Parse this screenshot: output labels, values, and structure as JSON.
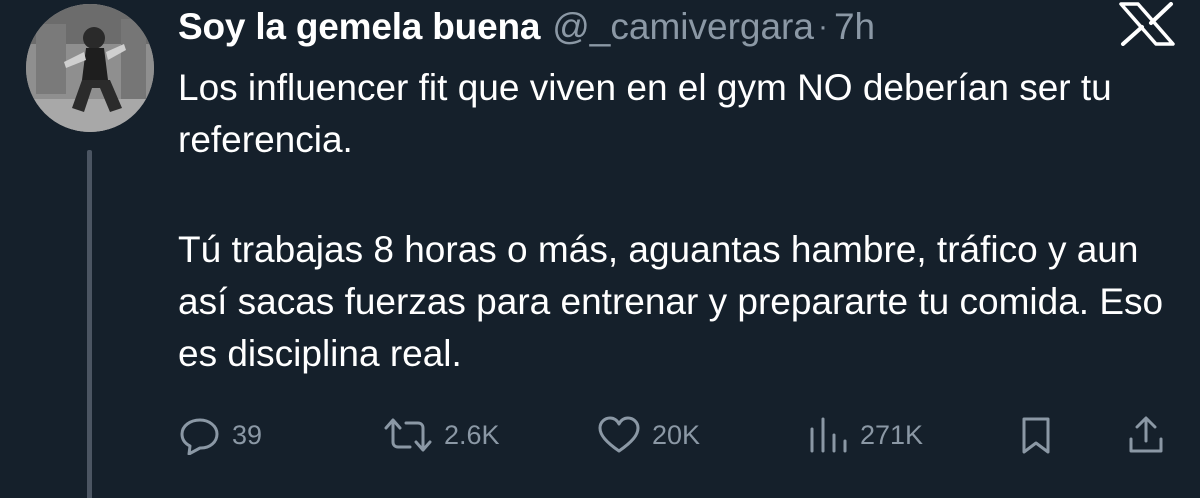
{
  "author": {
    "display_name": "Soy la gemela buena",
    "handle": "@_camivergara",
    "separator": "·",
    "time": "7h"
  },
  "tweet": {
    "paragraphs": [
      "Los influencer fit que viven en el gym NO deberían ser tu referencia.",
      "Tú trabajas 8 horas o más, aguantas hambre, tráfico y aun así sacas fuerzas para entrenar y prepararte tu comida. Eso es disciplina real."
    ]
  },
  "actions": {
    "replies": "39",
    "reposts": "2.6K",
    "likes": "20K",
    "views": "271K"
  },
  "icons": {
    "brand": "x-logo-icon",
    "reply": "reply-icon",
    "repost": "repost-icon",
    "like": "heart-icon",
    "views": "views-icon",
    "bookmark": "bookmark-icon",
    "share": "share-icon"
  },
  "colors": {
    "background": "#15202b",
    "text": "#ffffff",
    "muted": "#8b98a5"
  }
}
